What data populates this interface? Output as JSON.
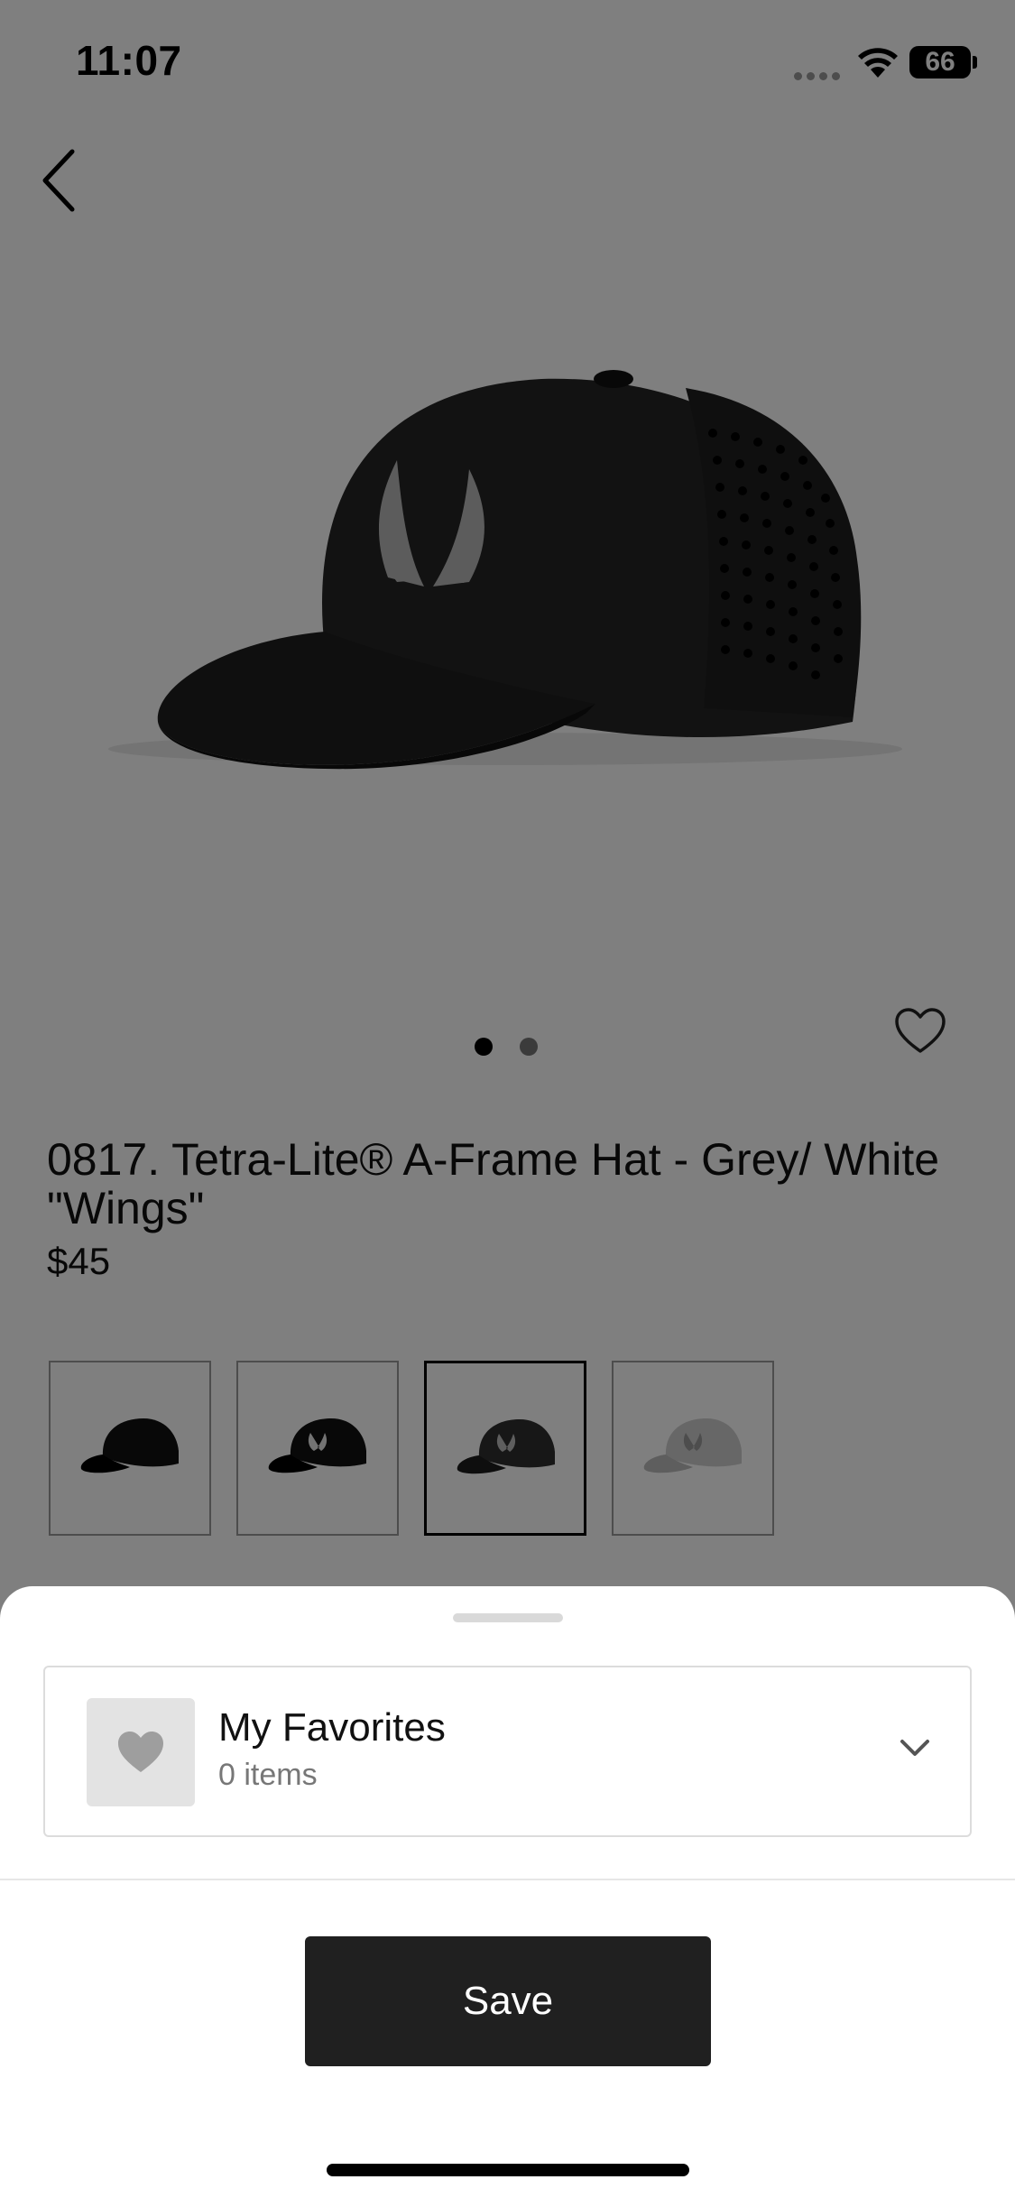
{
  "status_bar": {
    "time": "11:07",
    "battery": "66"
  },
  "product": {
    "title": "0817. Tetra-Lite® A-Frame Hat - Grey/ White \"Wings\"",
    "price": "$45",
    "image_pages": 2,
    "current_page": 1,
    "swatches": [
      {
        "name": "black",
        "color": "#1a1a1a"
      },
      {
        "name": "black-white",
        "color": "#1a1a1a"
      },
      {
        "name": "grey-white",
        "color": "#333333",
        "selected": true
      },
      {
        "name": "light-grey",
        "color": "#d0d0d0"
      }
    ]
  },
  "sheet": {
    "list_name": "My Favorites",
    "list_count": "0 items",
    "save_label": "Save"
  },
  "colors": {
    "overlay": "rgba(0,0,0,0.5)",
    "button": "#202020",
    "thumb_bg": "#e3e3e3"
  }
}
